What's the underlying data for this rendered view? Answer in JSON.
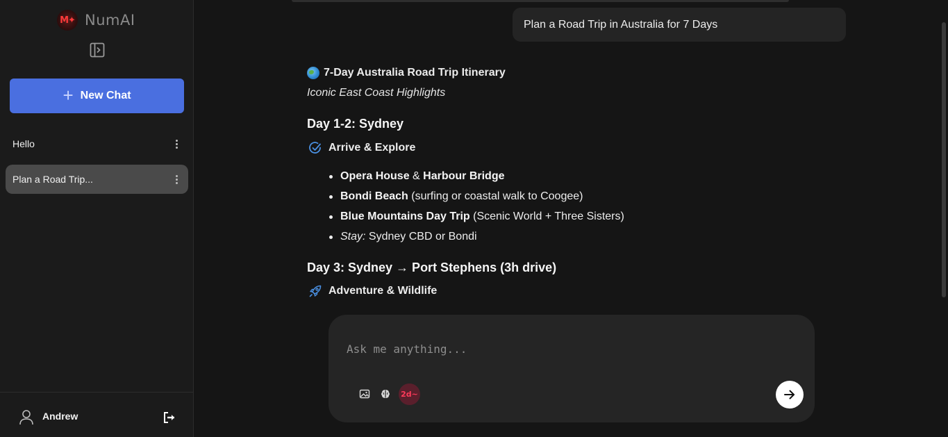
{
  "app": {
    "name": "NumAI",
    "logo_text": "M✦",
    "accent": "#4a6fe0"
  },
  "sidebar": {
    "new_chat_label": "New Chat",
    "chats": [
      {
        "label": "Hello",
        "active": false
      },
      {
        "label": "Plan a Road Trip...",
        "active": true
      }
    ],
    "user": {
      "name": "Andrew"
    }
  },
  "conversation": {
    "user_message": "Plan a Road Trip in Australia for 7 Days",
    "response": {
      "title": "7-Day Australia Road Trip Itinerary",
      "subtitle": "Iconic East Coast Highlights",
      "day1_heading": "Day 1-2: Sydney",
      "day1_section": "Arrive & Explore",
      "bullets": [
        {
          "bold1": "Opera House",
          "mid": " & ",
          "bold2": "Harbour Bridge",
          "rest": ""
        },
        {
          "bold1": "Bondi Beach",
          "mid": "",
          "bold2": "",
          "rest": " (surfing or coastal walk to Coogee)"
        },
        {
          "bold1": "Blue Mountains Day Trip",
          "mid": "",
          "bold2": "",
          "rest": " (Scenic World + Three Sisters)"
        }
      ],
      "stay_label": "Stay:",
      "stay_value": " Sydney CBD or Bondi",
      "day3_heading": "Day 3: Sydney → Port Stephens (3h drive)",
      "day3_section": "Adventure & Wildlife"
    }
  },
  "composer": {
    "placeholder": "Ask me anything...",
    "model_badge": "2d~"
  }
}
